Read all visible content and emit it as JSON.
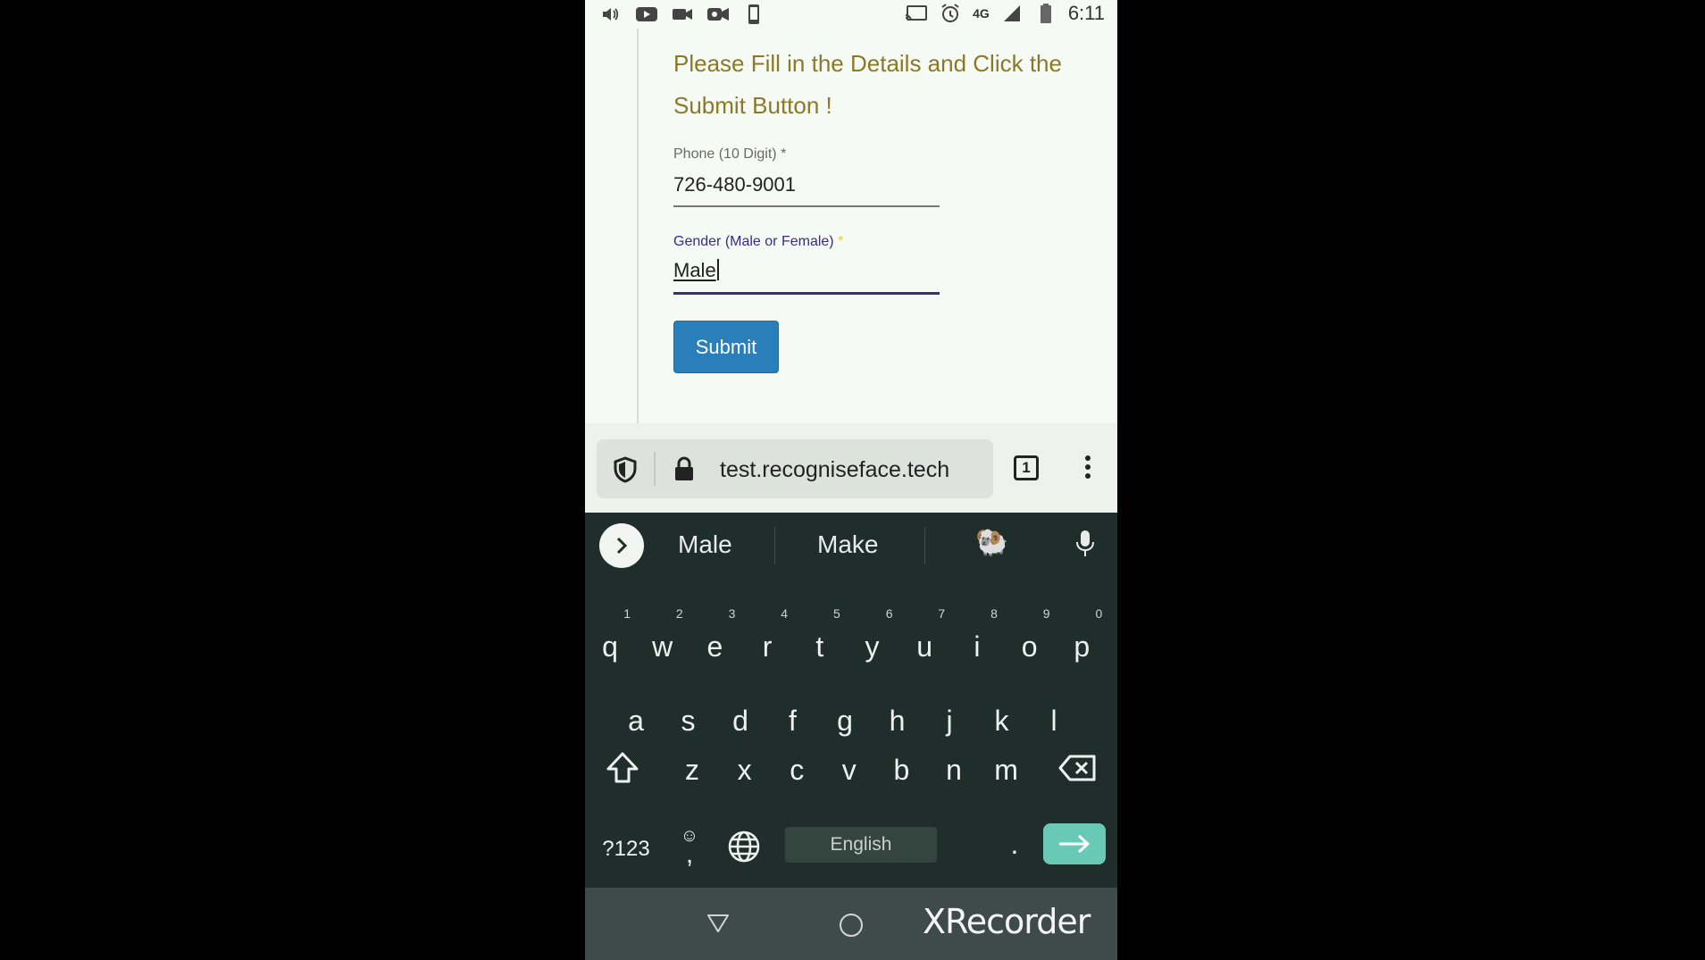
{
  "status_bar": {
    "network": "4G",
    "time": "6:11",
    "icons": [
      "volume-icon",
      "youtube-icon",
      "video-camera-icon",
      "video-camera-icon",
      "phone-icon",
      "cast-icon",
      "alarm-icon",
      "signal-icon",
      "battery-icon"
    ]
  },
  "form": {
    "headline": "Please Fill in the Details and Click the Submit Button !",
    "phone_label": "Phone (10 Digit)",
    "phone_required": "*",
    "phone_value": "726-480-9001",
    "gender_label": "Gender (Male or Female)",
    "gender_required": "*",
    "gender_value": "Male",
    "submit_label": "Submit",
    "colors": {
      "headline": "#8a7a28",
      "button": "#2a7fba",
      "focus": "#3a2a88"
    }
  },
  "browser": {
    "url": "test.recogniseface.tech",
    "tab_count": "1"
  },
  "keyboard": {
    "suggestions": [
      "Male",
      "Make"
    ],
    "emoji_suggestion": "🐏",
    "row1": [
      {
        "key": "q",
        "num": "1"
      },
      {
        "key": "w",
        "num": "2"
      },
      {
        "key": "e",
        "num": "3"
      },
      {
        "key": "r",
        "num": "4"
      },
      {
        "key": "t",
        "num": "5"
      },
      {
        "key": "y",
        "num": "6"
      },
      {
        "key": "u",
        "num": "7"
      },
      {
        "key": "i",
        "num": "8"
      },
      {
        "key": "o",
        "num": "9"
      },
      {
        "key": "p",
        "num": "0"
      }
    ],
    "row2": [
      "a",
      "s",
      "d",
      "f",
      "g",
      "h",
      "j",
      "k",
      "l"
    ],
    "row3": [
      "z",
      "x",
      "c",
      "v",
      "b",
      "n",
      "m"
    ],
    "symbols_label": "?123",
    "comma_label": ",",
    "emoji_label": "☺",
    "space_label": "English",
    "period_label": "."
  },
  "watermark": "XRecorder"
}
